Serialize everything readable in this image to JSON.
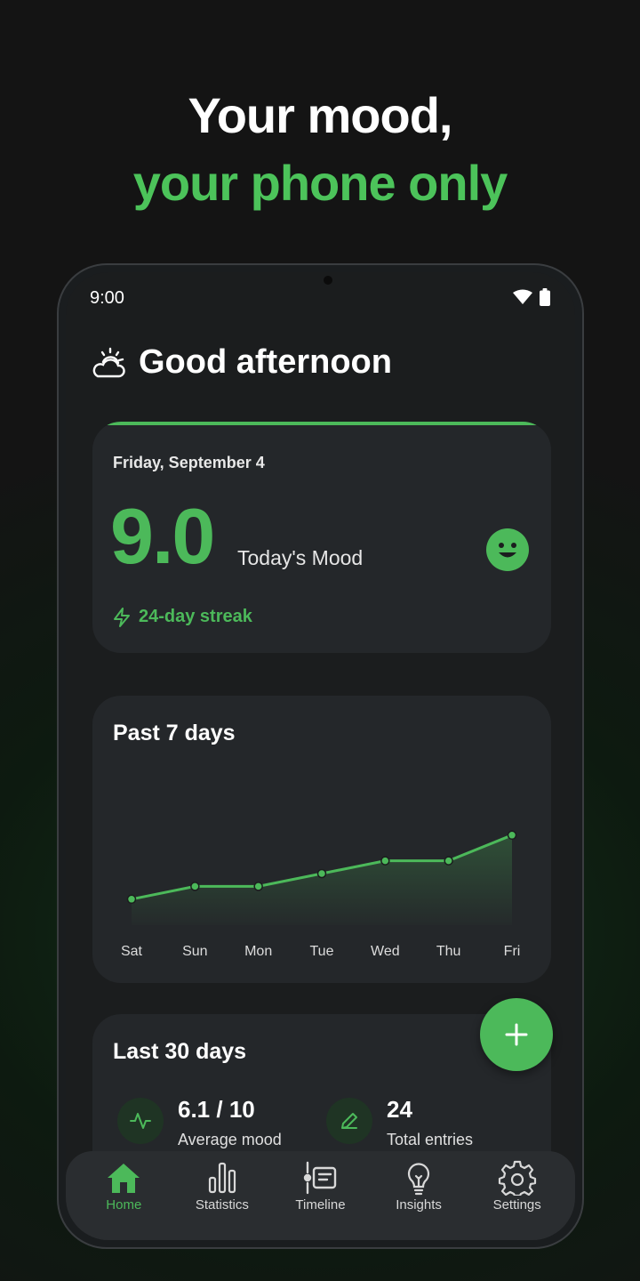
{
  "headline": {
    "line1": "Your mood,",
    "line2": "your phone only"
  },
  "status_bar": {
    "time": "9:00",
    "icons": [
      "wifi-icon",
      "battery-icon"
    ]
  },
  "greeting": {
    "icon": "partly-cloudy-icon",
    "text": "Good afternoon"
  },
  "today_card": {
    "date": "Friday, September 4",
    "mood_value": "9.0",
    "mood_label": "Today's Mood",
    "mood_icon": "smiley-face-icon",
    "streak": "24-day streak"
  },
  "week_card": {
    "title": "Past 7 days",
    "chart_data": {
      "type": "area",
      "categories": [
        "Sat",
        "Sun",
        "Mon",
        "Tue",
        "Wed",
        "Thu",
        "Fri"
      ],
      "values": [
        6.9,
        7.2,
        7.2,
        7.5,
        7.8,
        7.8,
        8.4
      ],
      "ylim": [
        5,
        10
      ],
      "grid": false
    }
  },
  "month_card": {
    "title": "Last 30 days",
    "stats": [
      {
        "value": "6.1 / 10",
        "label": "Average mood",
        "icon": "activity-icon"
      },
      {
        "value": "24",
        "label": "Total entries",
        "icon": "pencil-icon"
      }
    ]
  },
  "fab": {
    "icon": "plus-icon"
  },
  "nav": {
    "items": [
      {
        "label": "Home",
        "icon": "home-icon",
        "active": true
      },
      {
        "label": "Statistics",
        "icon": "bar-chart-icon",
        "active": false
      },
      {
        "label": "Timeline",
        "icon": "timeline-icon",
        "active": false
      },
      {
        "label": "Insights",
        "icon": "lightbulb-icon",
        "active": false
      },
      {
        "label": "Settings",
        "icon": "gear-icon",
        "active": false
      }
    ]
  },
  "colors": {
    "accent": "#4cb95a",
    "card": "#24272a",
    "background": "#141414"
  }
}
